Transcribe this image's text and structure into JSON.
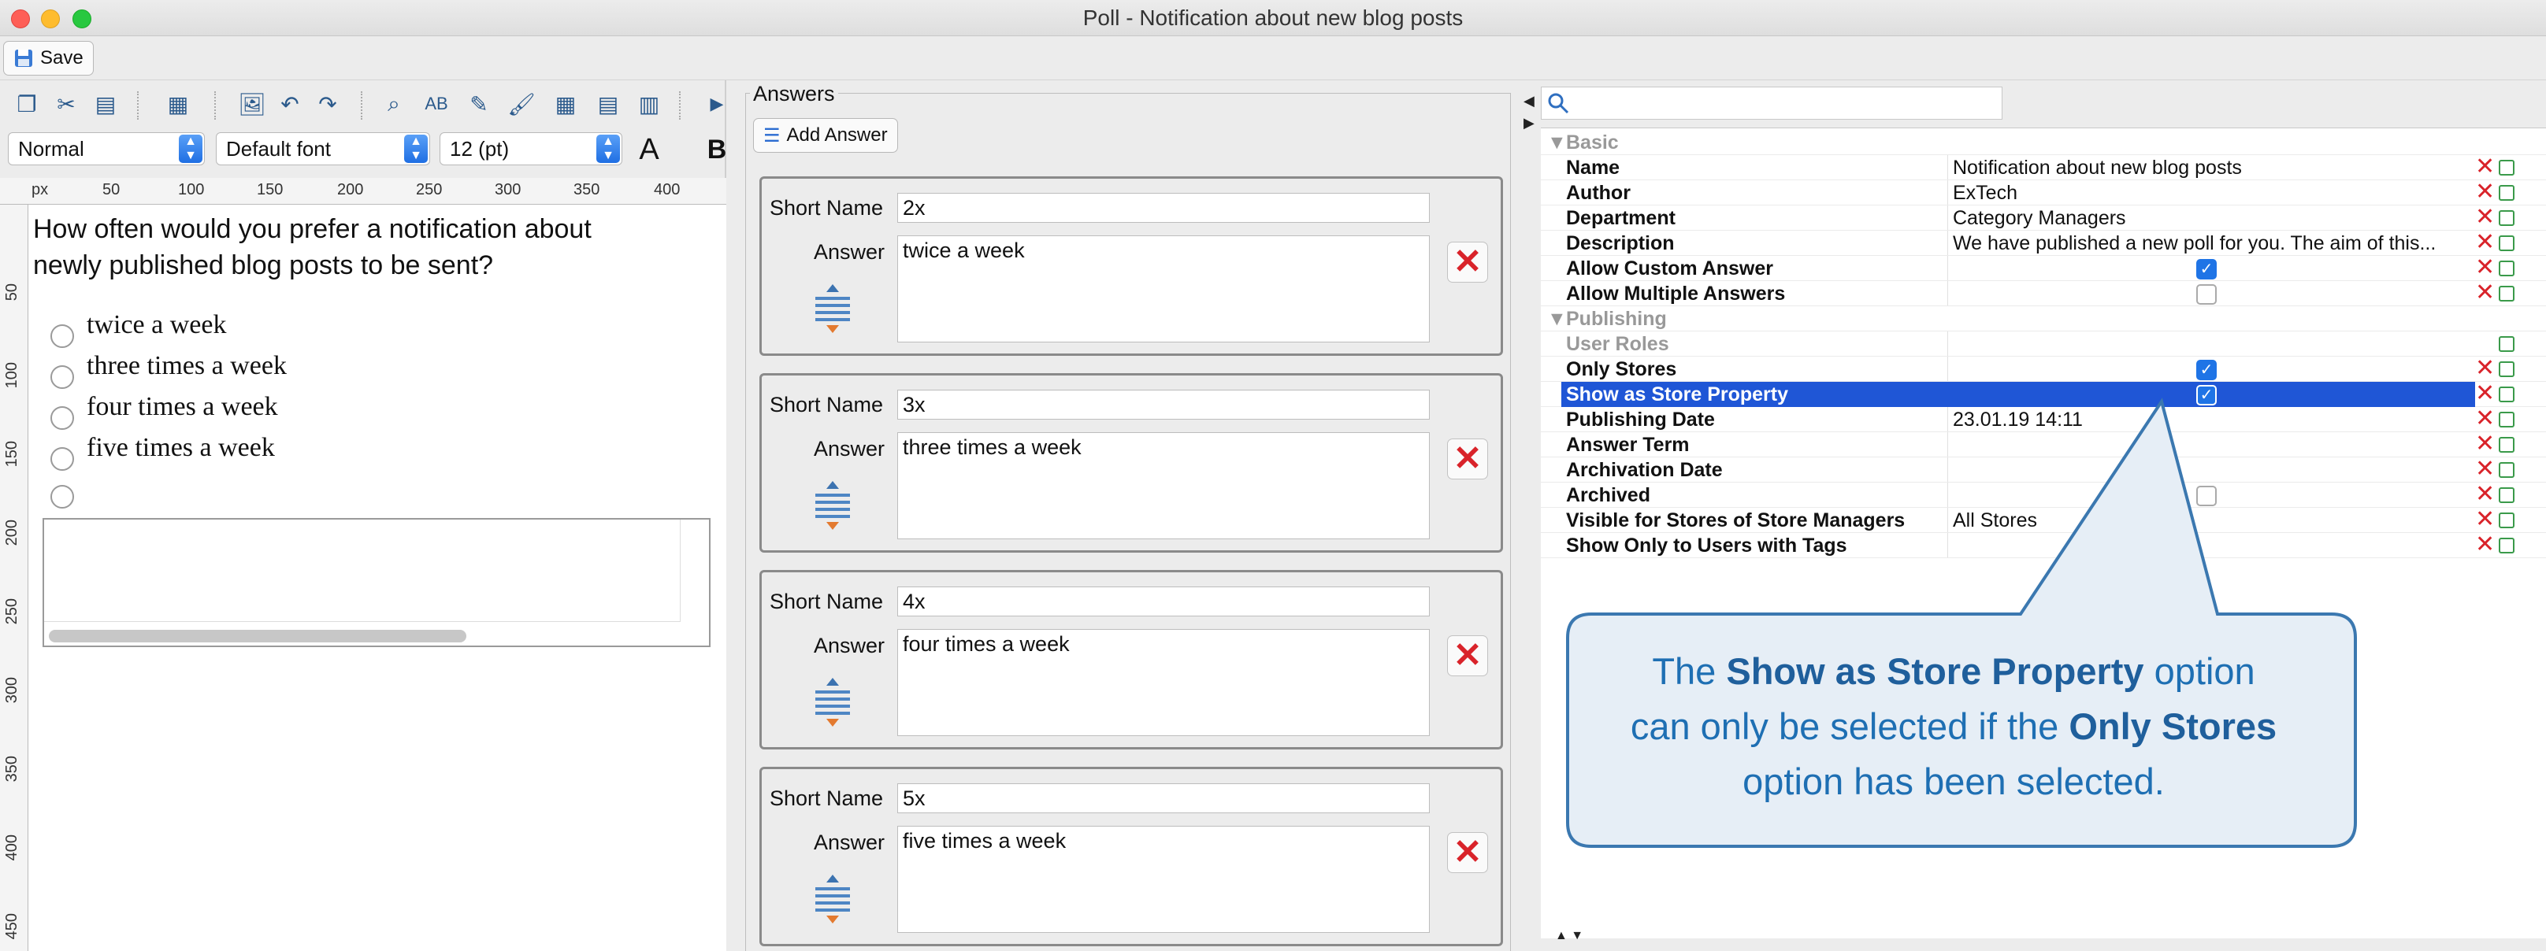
{
  "window": {
    "title": "Poll - Notification about new blog posts"
  },
  "toolbar": {
    "save_label": "Save"
  },
  "format": {
    "style": "Normal",
    "font": "Default font",
    "size": "12 (pt)"
  },
  "ruler": {
    "unit": "px",
    "h_ticks": [
      "50",
      "100",
      "150",
      "200",
      "250",
      "300",
      "350",
      "400"
    ],
    "v_ticks": [
      "50",
      "100",
      "150",
      "200",
      "250",
      "300",
      "350",
      "400",
      "450"
    ]
  },
  "question": {
    "text_line1": "How often would you prefer a notification about",
    "text_line2": "newly published blog posts to be sent?",
    "options": [
      "twice a week",
      "three times a week",
      "four times a week",
      "five times a week"
    ]
  },
  "answers": {
    "section_title": "Answers",
    "add_label": "Add Answer",
    "short_name_label": "Short Name",
    "answer_label": "Answer",
    "items": [
      {
        "short": "2x",
        "answer": "twice a week"
      },
      {
        "short": "3x",
        "answer": "three times a week"
      },
      {
        "short": "4x",
        "answer": "four times a week"
      },
      {
        "short": "5x",
        "answer": "five times a week"
      }
    ]
  },
  "properties": {
    "search_placeholder": "",
    "group_basic": "Basic",
    "group_publishing": "Publishing",
    "rows": [
      {
        "name": "Name",
        "value": "Notification about new blog posts"
      },
      {
        "name": "Author",
        "value": "ExTech"
      },
      {
        "name": "Department",
        "value": "Category Managers"
      },
      {
        "name": "Description",
        "value": "We have published a new poll for you. The aim of this..."
      },
      {
        "name": "Allow Custom Answer",
        "checked": true
      },
      {
        "name": "Allow Multiple Answers",
        "checked": false
      },
      {
        "name": "User Roles",
        "value": ""
      },
      {
        "name": "Only Stores",
        "checked": true
      },
      {
        "name": "Show as Store Property",
        "checked": true,
        "selected": true
      },
      {
        "name": "Publishing Date",
        "value": "23.01.19 14:11"
      },
      {
        "name": "Answer Term",
        "value": ""
      },
      {
        "name": "Archivation Date",
        "value": ""
      },
      {
        "name": "Archived",
        "checked": false
      },
      {
        "name": "Visible for Stores of Store Managers",
        "value": "All Stores"
      },
      {
        "name": "Show Only to Users with Tags",
        "value": ""
      }
    ]
  },
  "callout": {
    "line1_pre": "The ",
    "line1_bold": "Show as Store Property",
    "line1_post": " option",
    "line2_pre": "can only be selected if the ",
    "line2_bold": "Only Stores",
    "line3": "option has been selected."
  },
  "colors": {
    "accent": "#1f74e6",
    "delete": "#d9232a",
    "callout_text": "#1e6fb3",
    "callout_bg": "#e6eef6",
    "callout_border": "#3b78b0"
  }
}
